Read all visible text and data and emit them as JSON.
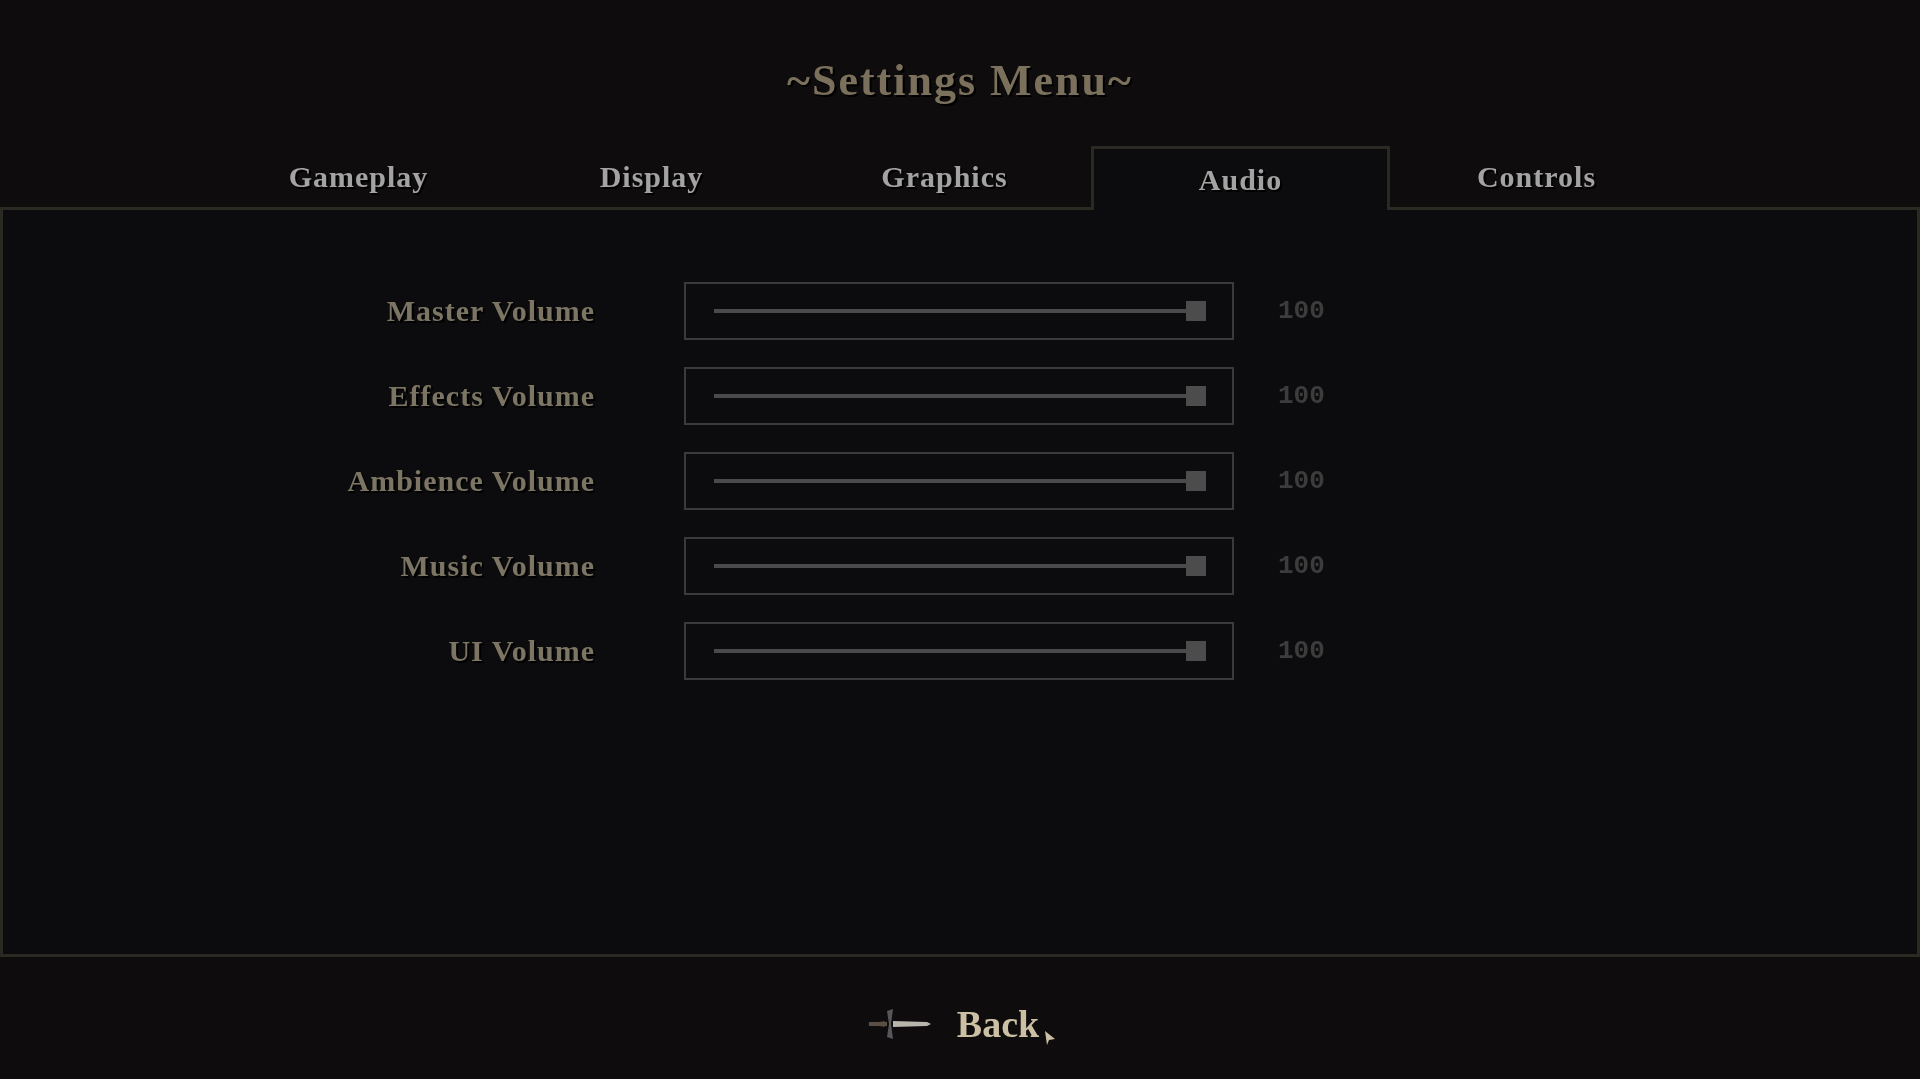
{
  "title": "~Settings Menu~",
  "tabs": [
    {
      "label": "Gameplay",
      "selected": false
    },
    {
      "label": "Display",
      "selected": false
    },
    {
      "label": "Graphics",
      "selected": false
    },
    {
      "label": "Audio",
      "selected": true
    },
    {
      "label": "Controls",
      "selected": false
    }
  ],
  "sliders": [
    {
      "label": "Master Volume",
      "level": 1,
      "reading": "100"
    },
    {
      "label": "Effects Volume",
      "level": 1,
      "reading": "100"
    },
    {
      "label": "Ambience Volume",
      "level": 1,
      "reading": "100"
    },
    {
      "label": "Music Volume",
      "level": 1,
      "reading": "100"
    },
    {
      "label": "UI Volume",
      "level": 1,
      "reading": "100"
    }
  ],
  "back_button": {
    "label": "Back"
  }
}
